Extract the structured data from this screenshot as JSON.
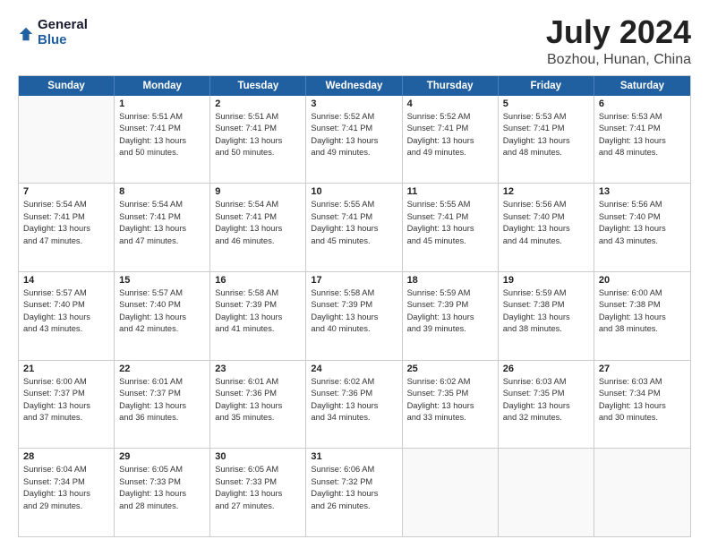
{
  "logo": {
    "general": "General",
    "blue": "Blue"
  },
  "title": "July 2024",
  "subtitle": "Bozhou, Hunan, China",
  "header_days": [
    "Sunday",
    "Monday",
    "Tuesday",
    "Wednesday",
    "Thursday",
    "Friday",
    "Saturday"
  ],
  "weeks": [
    [
      {
        "day": "",
        "info": ""
      },
      {
        "day": "1",
        "info": "Sunrise: 5:51 AM\nSunset: 7:41 PM\nDaylight: 13 hours\nand 50 minutes."
      },
      {
        "day": "2",
        "info": "Sunrise: 5:51 AM\nSunset: 7:41 PM\nDaylight: 13 hours\nand 50 minutes."
      },
      {
        "day": "3",
        "info": "Sunrise: 5:52 AM\nSunset: 7:41 PM\nDaylight: 13 hours\nand 49 minutes."
      },
      {
        "day": "4",
        "info": "Sunrise: 5:52 AM\nSunset: 7:41 PM\nDaylight: 13 hours\nand 49 minutes."
      },
      {
        "day": "5",
        "info": "Sunrise: 5:53 AM\nSunset: 7:41 PM\nDaylight: 13 hours\nand 48 minutes."
      },
      {
        "day": "6",
        "info": "Sunrise: 5:53 AM\nSunset: 7:41 PM\nDaylight: 13 hours\nand 48 minutes."
      }
    ],
    [
      {
        "day": "7",
        "info": "Sunrise: 5:54 AM\nSunset: 7:41 PM\nDaylight: 13 hours\nand 47 minutes."
      },
      {
        "day": "8",
        "info": "Sunrise: 5:54 AM\nSunset: 7:41 PM\nDaylight: 13 hours\nand 47 minutes."
      },
      {
        "day": "9",
        "info": "Sunrise: 5:54 AM\nSunset: 7:41 PM\nDaylight: 13 hours\nand 46 minutes."
      },
      {
        "day": "10",
        "info": "Sunrise: 5:55 AM\nSunset: 7:41 PM\nDaylight: 13 hours\nand 45 minutes."
      },
      {
        "day": "11",
        "info": "Sunrise: 5:55 AM\nSunset: 7:41 PM\nDaylight: 13 hours\nand 45 minutes."
      },
      {
        "day": "12",
        "info": "Sunrise: 5:56 AM\nSunset: 7:40 PM\nDaylight: 13 hours\nand 44 minutes."
      },
      {
        "day": "13",
        "info": "Sunrise: 5:56 AM\nSunset: 7:40 PM\nDaylight: 13 hours\nand 43 minutes."
      }
    ],
    [
      {
        "day": "14",
        "info": "Sunrise: 5:57 AM\nSunset: 7:40 PM\nDaylight: 13 hours\nand 43 minutes."
      },
      {
        "day": "15",
        "info": "Sunrise: 5:57 AM\nSunset: 7:40 PM\nDaylight: 13 hours\nand 42 minutes."
      },
      {
        "day": "16",
        "info": "Sunrise: 5:58 AM\nSunset: 7:39 PM\nDaylight: 13 hours\nand 41 minutes."
      },
      {
        "day": "17",
        "info": "Sunrise: 5:58 AM\nSunset: 7:39 PM\nDaylight: 13 hours\nand 40 minutes."
      },
      {
        "day": "18",
        "info": "Sunrise: 5:59 AM\nSunset: 7:39 PM\nDaylight: 13 hours\nand 39 minutes."
      },
      {
        "day": "19",
        "info": "Sunrise: 5:59 AM\nSunset: 7:38 PM\nDaylight: 13 hours\nand 38 minutes."
      },
      {
        "day": "20",
        "info": "Sunrise: 6:00 AM\nSunset: 7:38 PM\nDaylight: 13 hours\nand 38 minutes."
      }
    ],
    [
      {
        "day": "21",
        "info": "Sunrise: 6:00 AM\nSunset: 7:37 PM\nDaylight: 13 hours\nand 37 minutes."
      },
      {
        "day": "22",
        "info": "Sunrise: 6:01 AM\nSunset: 7:37 PM\nDaylight: 13 hours\nand 36 minutes."
      },
      {
        "day": "23",
        "info": "Sunrise: 6:01 AM\nSunset: 7:36 PM\nDaylight: 13 hours\nand 35 minutes."
      },
      {
        "day": "24",
        "info": "Sunrise: 6:02 AM\nSunset: 7:36 PM\nDaylight: 13 hours\nand 34 minutes."
      },
      {
        "day": "25",
        "info": "Sunrise: 6:02 AM\nSunset: 7:35 PM\nDaylight: 13 hours\nand 33 minutes."
      },
      {
        "day": "26",
        "info": "Sunrise: 6:03 AM\nSunset: 7:35 PM\nDaylight: 13 hours\nand 32 minutes."
      },
      {
        "day": "27",
        "info": "Sunrise: 6:03 AM\nSunset: 7:34 PM\nDaylight: 13 hours\nand 30 minutes."
      }
    ],
    [
      {
        "day": "28",
        "info": "Sunrise: 6:04 AM\nSunset: 7:34 PM\nDaylight: 13 hours\nand 29 minutes."
      },
      {
        "day": "29",
        "info": "Sunrise: 6:05 AM\nSunset: 7:33 PM\nDaylight: 13 hours\nand 28 minutes."
      },
      {
        "day": "30",
        "info": "Sunrise: 6:05 AM\nSunset: 7:33 PM\nDaylight: 13 hours\nand 27 minutes."
      },
      {
        "day": "31",
        "info": "Sunrise: 6:06 AM\nSunset: 7:32 PM\nDaylight: 13 hours\nand 26 minutes."
      },
      {
        "day": "",
        "info": ""
      },
      {
        "day": "",
        "info": ""
      },
      {
        "day": "",
        "info": ""
      }
    ]
  ]
}
